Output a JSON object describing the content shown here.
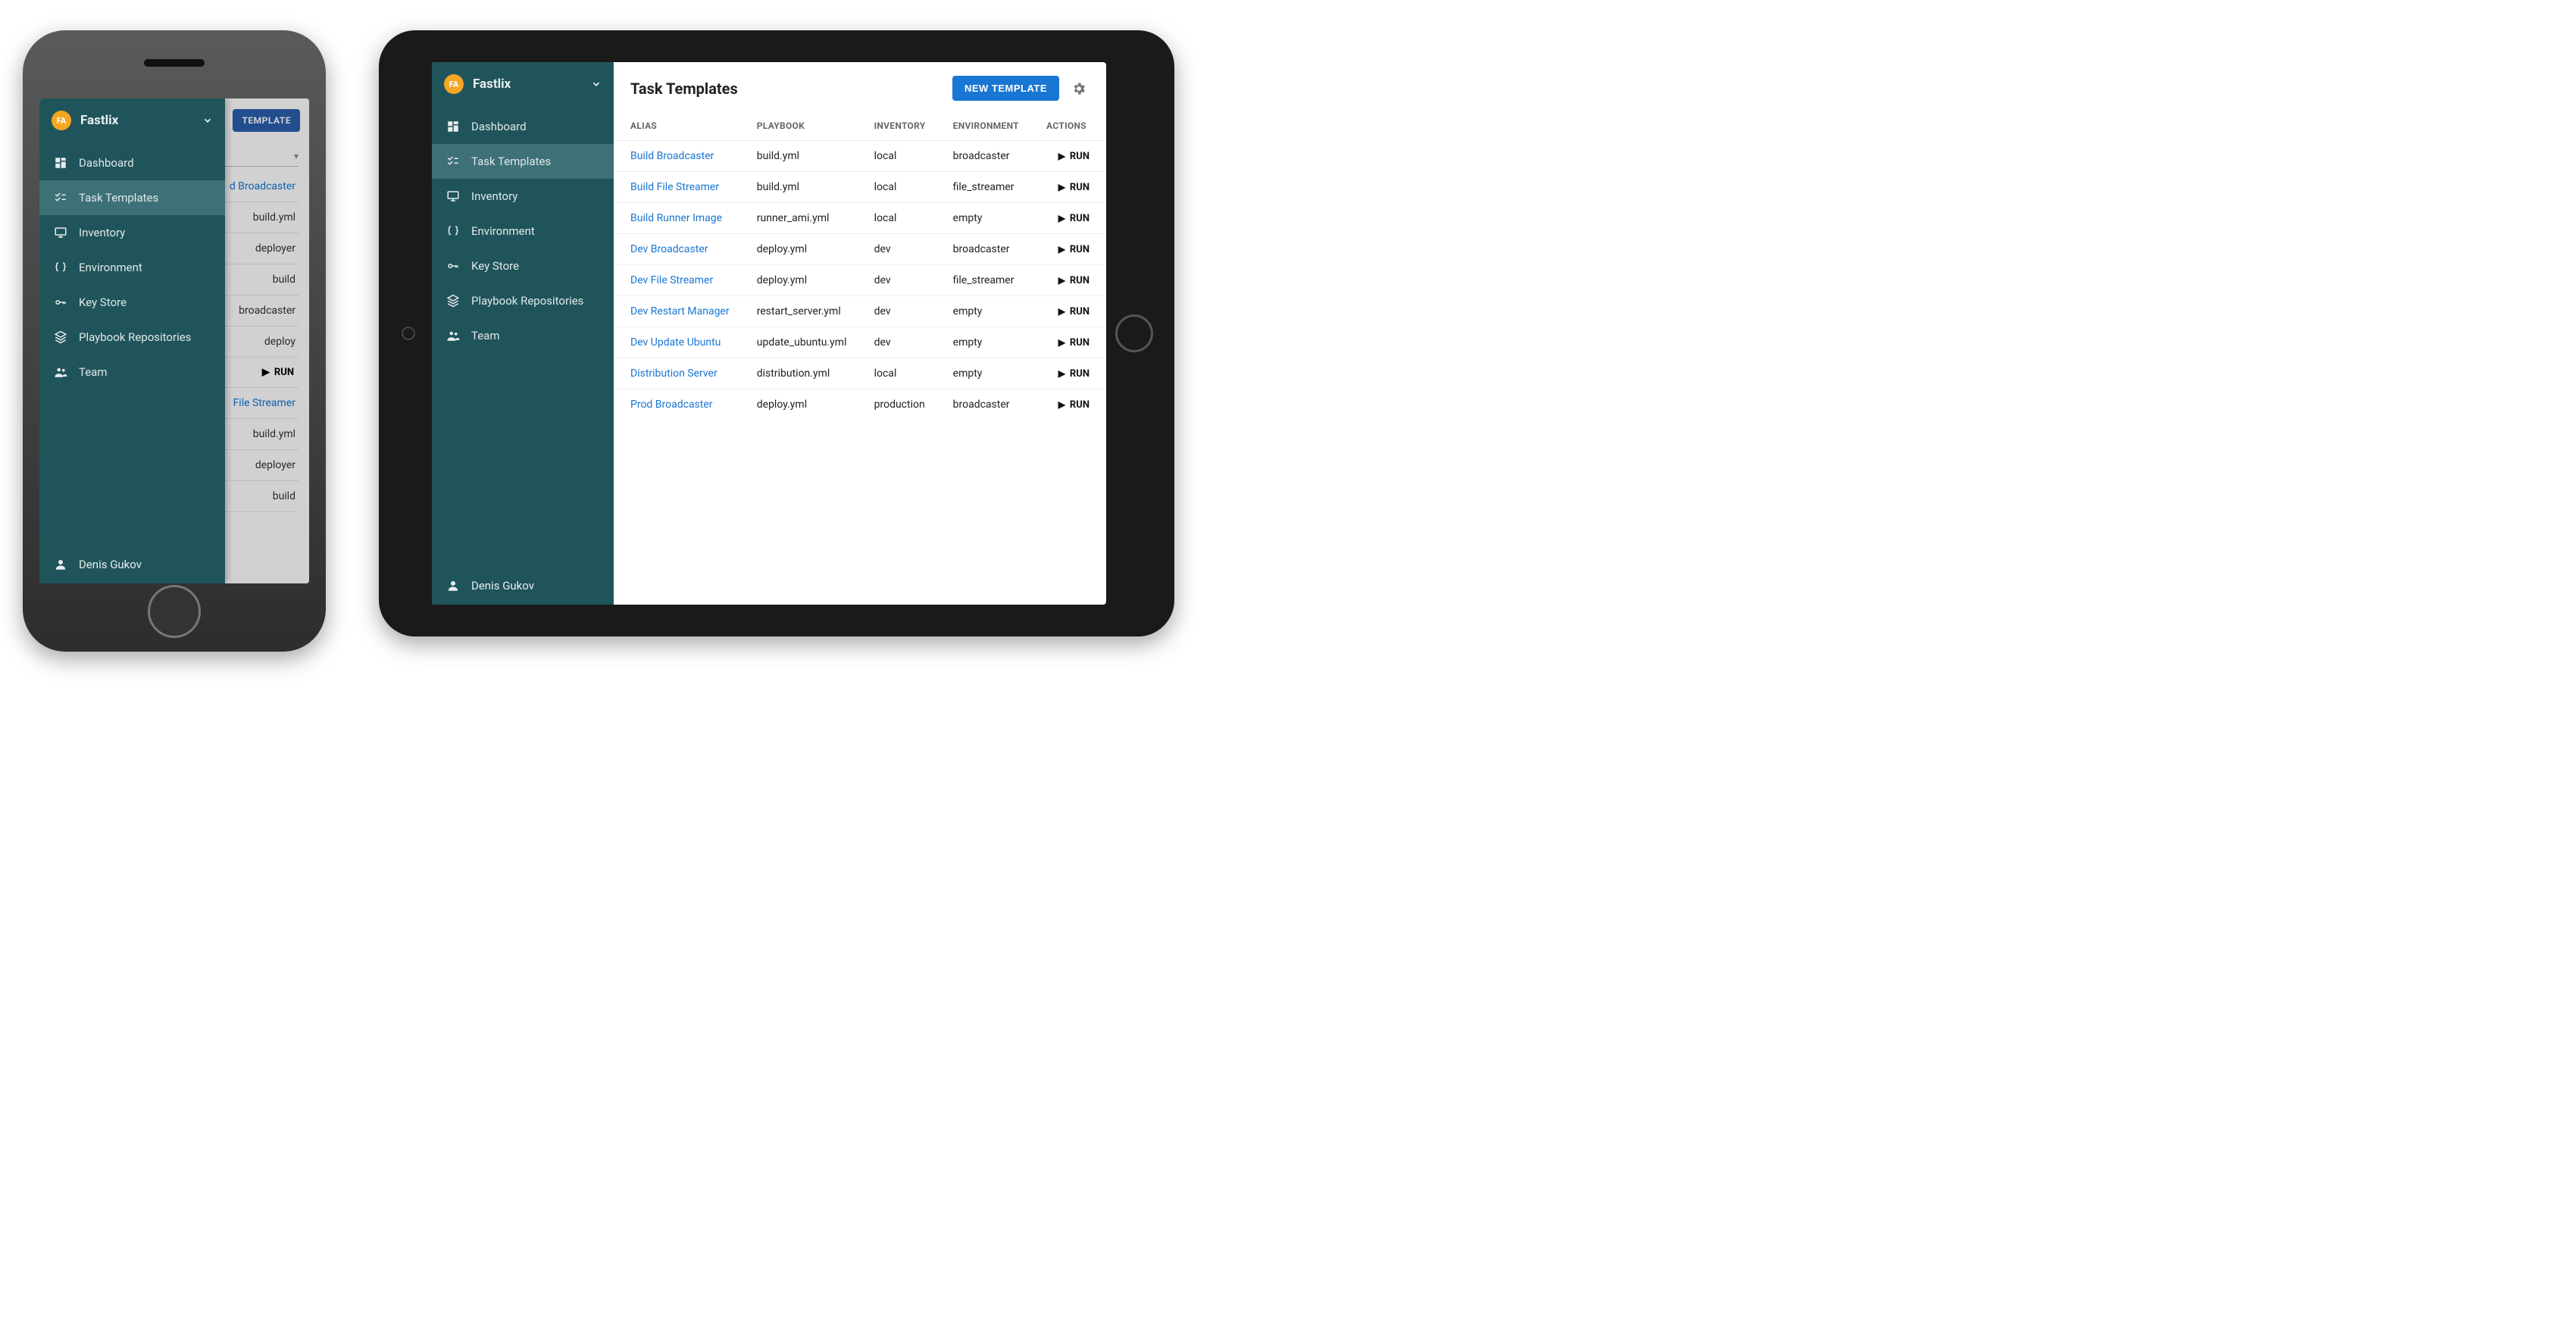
{
  "brand": {
    "logo_text": "FA",
    "name": "Fastlix"
  },
  "sidebar": {
    "items": [
      {
        "label": "Dashboard",
        "icon": "dashboard"
      },
      {
        "label": "Task Templates",
        "icon": "checklist"
      },
      {
        "label": "Inventory",
        "icon": "monitor"
      },
      {
        "label": "Environment",
        "icon": "braces"
      },
      {
        "label": "Key Store",
        "icon": "keys"
      },
      {
        "label": "Playbook Repositories",
        "icon": "repo"
      },
      {
        "label": "Team",
        "icon": "team"
      }
    ],
    "active_index": 1
  },
  "user": {
    "name": "Denis Gukov"
  },
  "page": {
    "title": "Task Templates",
    "new_button": "NEW TEMPLATE"
  },
  "table": {
    "headers": [
      "ALIAS",
      "PLAYBOOK",
      "INVENTORY",
      "ENVIRONMENT",
      "ACTIONS"
    ],
    "run_label": "RUN",
    "rows": [
      {
        "alias": "Build Broadcaster",
        "playbook": "build.yml",
        "inventory": "local",
        "environment": "broadcaster"
      },
      {
        "alias": "Build File Streamer",
        "playbook": "build.yml",
        "inventory": "local",
        "environment": "file_streamer"
      },
      {
        "alias": "Build Runner Image",
        "playbook": "runner_ami.yml",
        "inventory": "local",
        "environment": "empty"
      },
      {
        "alias": "Dev Broadcaster",
        "playbook": "deploy.yml",
        "inventory": "dev",
        "environment": "broadcaster"
      },
      {
        "alias": "Dev File Streamer",
        "playbook": "deploy.yml",
        "inventory": "dev",
        "environment": "file_streamer"
      },
      {
        "alias": "Dev Restart Manager",
        "playbook": "restart_server.yml",
        "inventory": "dev",
        "environment": "empty"
      },
      {
        "alias": "Dev Update Ubuntu",
        "playbook": "update_ubuntu.yml",
        "inventory": "dev",
        "environment": "empty"
      },
      {
        "alias": "Distribution Server",
        "playbook": "distribution.yml",
        "inventory": "local",
        "environment": "empty"
      },
      {
        "alias": "Prod Broadcaster",
        "playbook": "deploy.yml",
        "inventory": "production",
        "environment": "broadcaster"
      }
    ]
  },
  "phone_bg": {
    "button_tail": "TEMPLATE",
    "rows": [
      {
        "text": "d Broadcaster",
        "link": true
      },
      {
        "text": "build.yml"
      },
      {
        "text": "deployer"
      },
      {
        "text": "build"
      },
      {
        "text": "broadcaster"
      },
      {
        "text": "deploy"
      }
    ],
    "run_label": "RUN",
    "rows2": [
      {
        "text": "File Streamer",
        "link": true
      },
      {
        "text": "build.yml"
      },
      {
        "text": "deployer"
      },
      {
        "text": "build"
      }
    ]
  }
}
